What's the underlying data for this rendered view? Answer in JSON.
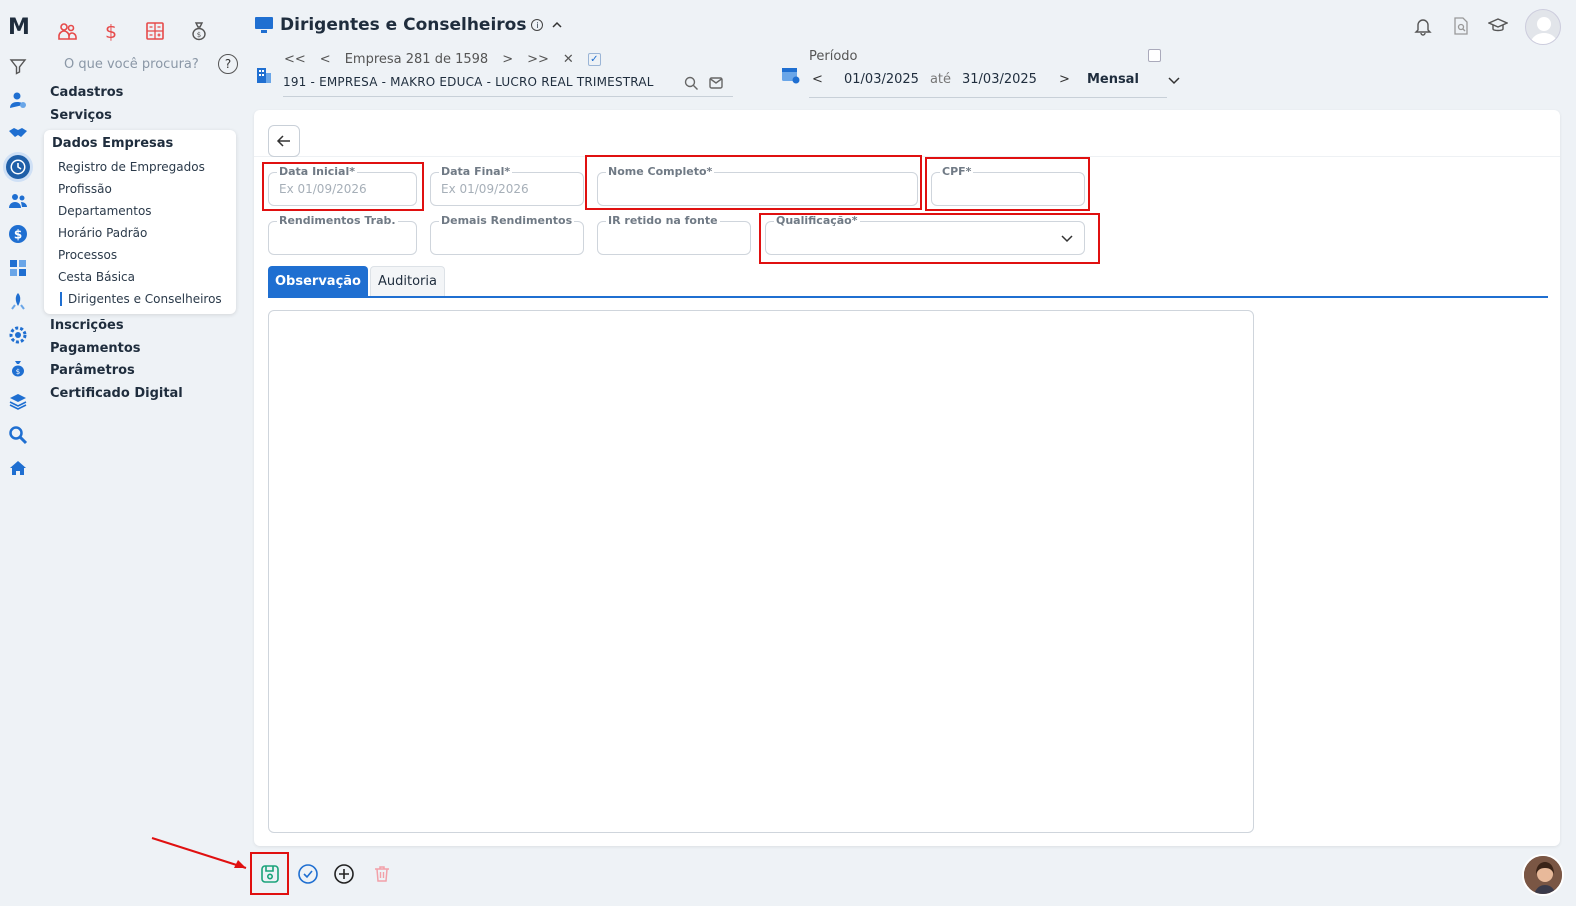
{
  "logo_text": "M",
  "sidebar": {
    "search_placeholder": "O que você procura?",
    "help_label": "?",
    "menu_top": [
      "Cadastros",
      "Serviços"
    ],
    "dados_empresas": {
      "title": "Dados Empresas",
      "items": [
        "Registro de Empregados",
        "Profissão",
        "Departamentos",
        "Horário Padrão",
        "Processos",
        "Cesta Básica",
        "Dirigentes e Conselheiros"
      ]
    },
    "menu_bottom": [
      "Inscrições",
      "Pagamentos",
      "Parâmetros",
      "Certificado Digital"
    ]
  },
  "header": {
    "title": "Dirigentes e Conselheiros",
    "info_label": "i",
    "empresa_nav": {
      "first": "<<",
      "prev": "<",
      "label": "Empresa 281 de 1598",
      "next": ">",
      "last": ">>",
      "close": "✕",
      "check": "✓"
    },
    "empresa_name": "191 - EMPRESA - MAKRO EDUCA - LUCRO REAL TRIMESTRAL",
    "periodo": {
      "label": "Período",
      "prev": "<",
      "start": "01/03/2025",
      "ate": "até",
      "end": "31/03/2025",
      "next": ">",
      "mode": "Mensal"
    }
  },
  "form": {
    "data_inicial": {
      "label": "Data Inicial*",
      "placeholder": "Ex 01/09/2026"
    },
    "data_final": {
      "label": "Data Final*",
      "placeholder": "Ex 01/09/2026"
    },
    "nome_completo": {
      "label": "Nome Completo*",
      "value": ""
    },
    "cpf": {
      "label": "CPF*",
      "value": ""
    },
    "rendimentos_trab": {
      "label": "Rendimentos Trab.",
      "value": ""
    },
    "demais_rendimentos": {
      "label": "Demais Rendimentos",
      "value": ""
    },
    "ir_retido": {
      "label": "IR retido na fonte",
      "value": ""
    },
    "qualificacao": {
      "label": "Qualificação*",
      "value": ""
    }
  },
  "tabs": [
    {
      "label": "Observação",
      "active": true
    },
    {
      "label": "Auditoria",
      "active": false
    }
  ],
  "observacao": "",
  "colors": {
    "accent": "#1f6fd1",
    "annotation_red": "#e01010",
    "module_red": "#e64a4a",
    "save_green": "#1aa37a",
    "delete_pink": "#f2a0a8"
  }
}
